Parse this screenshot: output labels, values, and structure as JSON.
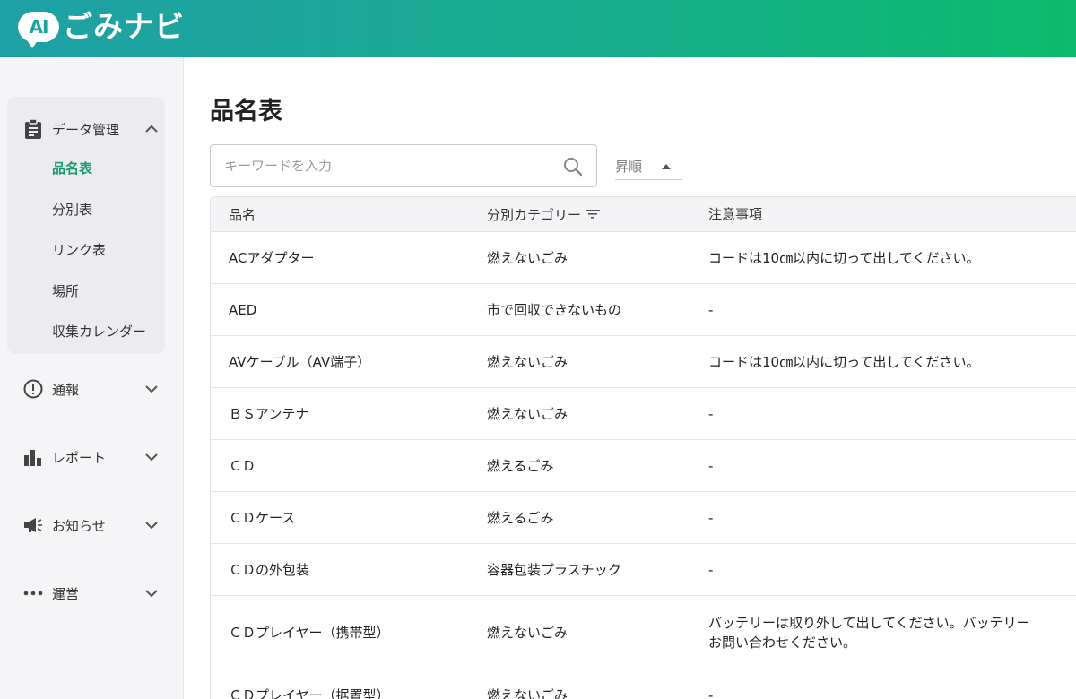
{
  "header": {
    "logo_badge": "AI",
    "logo_text": "ごみナビ"
  },
  "sidebar": {
    "groups": [
      {
        "label": "データ管理",
        "icon": "clipboard-icon",
        "expanded": true,
        "items": [
          {
            "label": "品名表",
            "active": true
          },
          {
            "label": "分別表"
          },
          {
            "label": "リンク表"
          },
          {
            "label": "場所"
          },
          {
            "label": "収集カレンダー"
          }
        ]
      },
      {
        "label": "通報",
        "icon": "alert-circle-icon"
      },
      {
        "label": "レポート",
        "icon": "bar-chart-icon"
      },
      {
        "label": "お知らせ",
        "icon": "megaphone-icon"
      },
      {
        "label": "運営",
        "icon": "more-dots-icon"
      }
    ]
  },
  "main": {
    "title": "品名表",
    "search": {
      "placeholder": "キーワードを入力",
      "value": ""
    },
    "sort": {
      "label": "昇順",
      "direction": "asc"
    },
    "table": {
      "headers": [
        "品名",
        "分別カテゴリー",
        "注意事項"
      ],
      "rows": [
        {
          "name": "ACアダプター",
          "category": "燃えないごみ",
          "note": "コードは10㎝以内に切って出してください。"
        },
        {
          "name": "AED",
          "category": "市で回収できないもの",
          "note": "-"
        },
        {
          "name": "AVケーブル（AV端子）",
          "category": "燃えないごみ",
          "note": "コードは10㎝以内に切って出してください。"
        },
        {
          "name": "ＢＳアンテナ",
          "category": "燃えないごみ",
          "note": "-"
        },
        {
          "name": "ＣＤ",
          "category": "燃えるごみ",
          "note": "-"
        },
        {
          "name": "ＣＤケース",
          "category": "燃えるごみ",
          "note": "-"
        },
        {
          "name": "ＣＤの外包装",
          "category": "容器包装プラスチック",
          "note": "-"
        },
        {
          "name": "ＣＤプレイヤー（携帯型）",
          "category": "燃えないごみ",
          "note": "バッテリーは取り外して出してください。バッテリー",
          "note2": "お問い合わせください。"
        },
        {
          "name": "ＣＤプレイヤー（据置型）",
          "category": "燃えないごみ",
          "note": "-"
        }
      ]
    }
  },
  "colors": {
    "header_start": "#1fa0a5",
    "header_end": "#0cbb6c",
    "active_nav": "#1b9b6e"
  }
}
